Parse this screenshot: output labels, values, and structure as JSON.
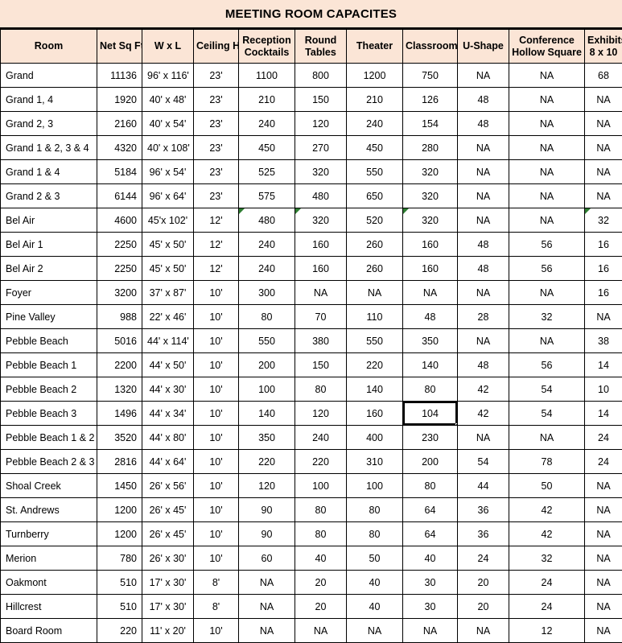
{
  "title": "MEETING ROOM CAPACITES",
  "columns": [
    {
      "key": "room",
      "label_lines": [
        "Room"
      ],
      "align": "left"
    },
    {
      "key": "sqft",
      "label_lines": [
        "Net Sq Ft"
      ],
      "align": "right"
    },
    {
      "key": "wxl",
      "label_lines": [
        "W x L"
      ],
      "align": "center"
    },
    {
      "key": "ceil",
      "label_lines": [
        "Ceiling Ht"
      ],
      "align": "center"
    },
    {
      "key": "recep",
      "label_lines": [
        "Reception",
        "Cocktails"
      ],
      "align": "center"
    },
    {
      "key": "round",
      "label_lines": [
        "Round",
        "Tables"
      ],
      "align": "center"
    },
    {
      "key": "thea",
      "label_lines": [
        "Theater"
      ],
      "align": "center"
    },
    {
      "key": "class",
      "label_lines": [
        "Classroom"
      ],
      "align": "center"
    },
    {
      "key": "ushape",
      "label_lines": [
        "U-Shape"
      ],
      "align": "center"
    },
    {
      "key": "conf",
      "label_lines": [
        "Conference",
        "Hollow Square"
      ],
      "align": "center"
    },
    {
      "key": "exh",
      "label_lines": [
        "Exhibits",
        "8 x 10"
      ],
      "align": "center"
    }
  ],
  "rows": [
    {
      "room": "Grand",
      "sqft": "11136",
      "wxl": "96' x 116'",
      "ceil": "23'",
      "recep": "1100",
      "round": "800",
      "thea": "1200",
      "class": "750",
      "ushape": "NA",
      "conf": "NA",
      "exh": "68"
    },
    {
      "room": "Grand 1, 4",
      "sqft": "1920",
      "wxl": "40' x 48'",
      "ceil": "23'",
      "recep": "210",
      "round": "150",
      "thea": "210",
      "class": "126",
      "ushape": "48",
      "conf": "NA",
      "exh": "NA"
    },
    {
      "room": "Grand 2, 3",
      "sqft": "2160",
      "wxl": "40' x 54'",
      "ceil": "23'",
      "recep": "240",
      "round": "120",
      "thea": "240",
      "class": "154",
      "ushape": "48",
      "conf": "NA",
      "exh": "NA"
    },
    {
      "room": "Grand 1 & 2, 3 & 4",
      "sqft": "4320",
      "wxl": "40' x 108'",
      "ceil": "23'",
      "recep": "450",
      "round": "270",
      "thea": "450",
      "class": "280",
      "ushape": "NA",
      "conf": "NA",
      "exh": "NA"
    },
    {
      "room": "Grand 1 & 4",
      "sqft": "5184",
      "wxl": "96' x 54'",
      "ceil": "23'",
      "recep": "525",
      "round": "320",
      "thea": "550",
      "class": "320",
      "ushape": "NA",
      "conf": "NA",
      "exh": "NA"
    },
    {
      "room": "Grand 2 & 3",
      "sqft": "6144",
      "wxl": "96' x 64'",
      "ceil": "23'",
      "recep": "575",
      "round": "480",
      "thea": "650",
      "class": "320",
      "ushape": "NA",
      "conf": "NA",
      "exh": "NA"
    },
    {
      "room": "Bel Air",
      "sqft": "4600",
      "wxl": "45'x 102'",
      "ceil": "12'",
      "recep": "480",
      "round": "320",
      "thea": "520",
      "class": "320",
      "ushape": "NA",
      "conf": "NA",
      "exh": "32",
      "comments": [
        "recep",
        "round",
        "class",
        "exh"
      ]
    },
    {
      "room": "Bel Air 1",
      "sqft": "2250",
      "wxl": "45' x 50'",
      "ceil": "12'",
      "recep": "240",
      "round": "160",
      "thea": "260",
      "class": "160",
      "ushape": "48",
      "conf": "56",
      "exh": "16"
    },
    {
      "room": "Bel Air 2",
      "sqft": "2250",
      "wxl": "45' x 50'",
      "ceil": "12'",
      "recep": "240",
      "round": "160",
      "thea": "260",
      "class": "160",
      "ushape": "48",
      "conf": "56",
      "exh": "16"
    },
    {
      "room": "Foyer",
      "sqft": "3200",
      "wxl": "37' x 87'",
      "ceil": "10'",
      "recep": "300",
      "round": "NA",
      "thea": "NA",
      "class": "NA",
      "ushape": "NA",
      "conf": "NA",
      "exh": "16"
    },
    {
      "room": "Pine Valley",
      "sqft": "988",
      "wxl": "22' x 46'",
      "ceil": "10'",
      "recep": "80",
      "round": "70",
      "thea": "110",
      "class": "48",
      "ushape": "28",
      "conf": "32",
      "exh": "NA"
    },
    {
      "room": "Pebble Beach",
      "sqft": "5016",
      "wxl": "44' x 114'",
      "ceil": "10'",
      "recep": "550",
      "round": "380",
      "thea": "550",
      "class": "350",
      "ushape": "NA",
      "conf": "NA",
      "exh": "38"
    },
    {
      "room": "Pebble Beach 1",
      "sqft": "2200",
      "wxl": "44' x 50'",
      "ceil": "10'",
      "recep": "200",
      "round": "150",
      "thea": "220",
      "class": "140",
      "ushape": "48",
      "conf": "56",
      "exh": "14"
    },
    {
      "room": "Pebble Beach 2",
      "sqft": "1320",
      "wxl": "44' x 30'",
      "ceil": "10'",
      "recep": "100",
      "round": "80",
      "thea": "140",
      "class": "80",
      "ushape": "42",
      "conf": "54",
      "exh": "10"
    },
    {
      "room": "Pebble Beach 3",
      "sqft": "1496",
      "wxl": "44' x 34'",
      "ceil": "10'",
      "recep": "140",
      "round": "120",
      "thea": "160",
      "class": "104",
      "ushape": "42",
      "conf": "54",
      "exh": "14",
      "selected": "class"
    },
    {
      "room": "Pebble Beach 1 & 2",
      "sqft": "3520",
      "wxl": "44' x 80'",
      "ceil": "10'",
      "recep": "350",
      "round": "240",
      "thea": "400",
      "class": "230",
      "ushape": "NA",
      "conf": "NA",
      "exh": "24"
    },
    {
      "room": "Pebble Beach 2 & 3",
      "sqft": "2816",
      "wxl": "44' x 64'",
      "ceil": "10'",
      "recep": "220",
      "round": "220",
      "thea": "310",
      "class": "200",
      "ushape": "54",
      "conf": "78",
      "exh": "24"
    },
    {
      "room": "Shoal Creek",
      "sqft": "1450",
      "wxl": "26' x 56'",
      "ceil": "10'",
      "recep": "120",
      "round": "100",
      "thea": "100",
      "class": "80",
      "ushape": "44",
      "conf": "50",
      "exh": "NA"
    },
    {
      "room": "St. Andrews",
      "sqft": "1200",
      "wxl": "26' x 45'",
      "ceil": "10'",
      "recep": "90",
      "round": "80",
      "thea": "80",
      "class": "64",
      "ushape": "36",
      "conf": "42",
      "exh": "NA"
    },
    {
      "room": "Turnberry",
      "sqft": "1200",
      "wxl": "26' x 45'",
      "ceil": "10'",
      "recep": "90",
      "round": "80",
      "thea": "80",
      "class": "64",
      "ushape": "36",
      "conf": "42",
      "exh": "NA"
    },
    {
      "room": "Merion",
      "sqft": "780",
      "wxl": "26' x 30'",
      "ceil": "10'",
      "recep": "60",
      "round": "40",
      "thea": "50",
      "class": "40",
      "ushape": "24",
      "conf": "32",
      "exh": "NA"
    },
    {
      "room": "Oakmont",
      "sqft": "510",
      "wxl": "17' x 30'",
      "ceil": "8'",
      "recep": "NA",
      "round": "20",
      "thea": "40",
      "class": "30",
      "ushape": "20",
      "conf": "24",
      "exh": "NA"
    },
    {
      "room": "Hillcrest",
      "sqft": "510",
      "wxl": "17' x 30'",
      "ceil": "8'",
      "recep": "NA",
      "round": "20",
      "thea": "40",
      "class": "30",
      "ushape": "20",
      "conf": "24",
      "exh": "NA"
    },
    {
      "room": "Board Room",
      "sqft": "220",
      "wxl": "11' x 20'",
      "ceil": "10'",
      "recep": "NA",
      "round": "NA",
      "thea": "NA",
      "class": "NA",
      "ushape": "NA",
      "conf": "12",
      "exh": "NA"
    }
  ],
  "colors": {
    "header_fill": "#FBE5D6",
    "grid_line": "#000000",
    "comment_flag": "#2E7D32",
    "cell_fill": "#FFFFFF"
  }
}
